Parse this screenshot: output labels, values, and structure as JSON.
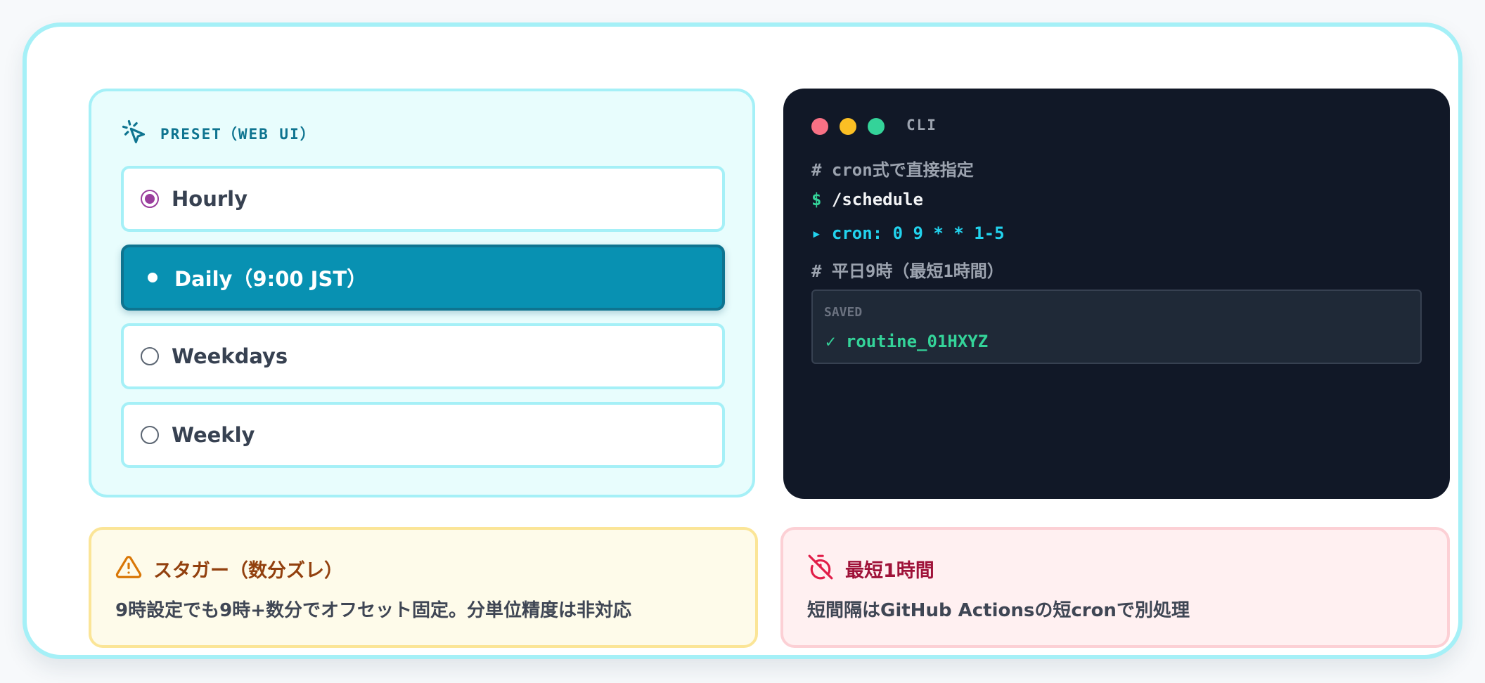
{
  "preset": {
    "title": "PRESET（WEB UI）",
    "icon": "pointer-click-icon",
    "accent": "#0e7490",
    "options": [
      {
        "label": "Hourly",
        "state": "checked"
      },
      {
        "label": "Daily（9:00 JST）",
        "state": "selected"
      },
      {
        "label": "Weekdays",
        "state": "unchecked"
      },
      {
        "label": "Weekly",
        "state": "unchecked"
      }
    ]
  },
  "cli": {
    "title": "CLI",
    "traffic_colors": [
      "#f87185",
      "#fbbf24",
      "#34d399"
    ],
    "lines": [
      {
        "text": "# cron式で直接指定",
        "kind": "comment"
      },
      {
        "prompt": "$",
        "text": "/schedule",
        "kind": "command"
      },
      {
        "text": "▸ cron: 0 9 * * 1-5",
        "kind": "output"
      },
      {
        "text": "# 平日9時（最短1時間）",
        "kind": "comment"
      }
    ],
    "saved": {
      "label": "SAVED",
      "value": "✓ routine_01HXYZ"
    }
  },
  "notes": {
    "stagger": {
      "icon": "warning-icon",
      "title": "スタガー（数分ズレ）",
      "body": "9時設定でも9時+数分でオフセット固定。分単位精度は非対応",
      "color": "#92400e"
    },
    "min_interval": {
      "icon": "timer-off-icon",
      "title": "最短1時間",
      "body": "短間隔はGitHub Actionsの短cronで別処理",
      "color": "#9f1239"
    }
  }
}
